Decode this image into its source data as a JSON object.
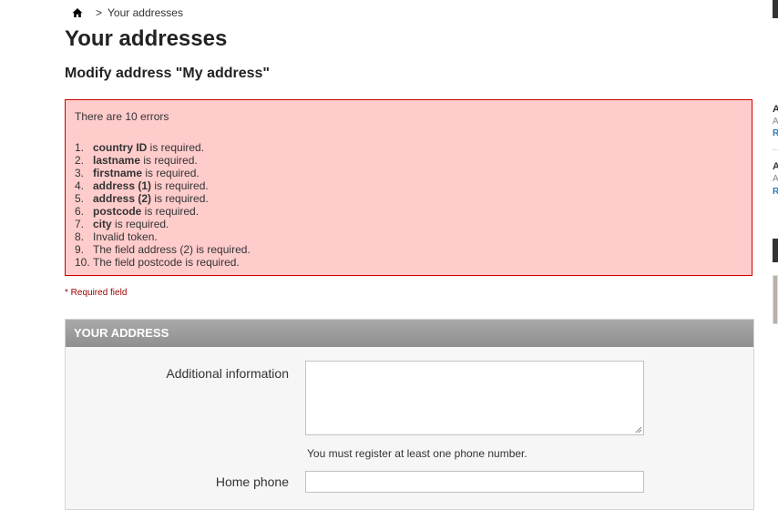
{
  "breadcrumb": {
    "home_icon": "home-icon",
    "separator": ">",
    "current": "Your addresses"
  },
  "page": {
    "title": "Your addresses",
    "subtitle": "Modify address \"My address\""
  },
  "errors": {
    "count_text": "There are 10 errors",
    "items": [
      {
        "num": "1.",
        "bold": "country ID",
        "rest": " is required."
      },
      {
        "num": "2.",
        "bold": "lastname",
        "rest": " is required."
      },
      {
        "num": "3.",
        "bold": "firstname",
        "rest": " is required."
      },
      {
        "num": "4.",
        "bold": "address (1)",
        "rest": " is required."
      },
      {
        "num": "5.",
        "bold": "address (2)",
        "rest": " is required."
      },
      {
        "num": "6.",
        "bold": "postcode",
        "rest": " is required."
      },
      {
        "num": "7.",
        "bold": "city",
        "rest": " is required."
      },
      {
        "num": "8.",
        "bold": "",
        "rest": "Invalid token."
      },
      {
        "num": "9.",
        "bold": "",
        "rest": "The field address (2) is required."
      },
      {
        "num": "10.",
        "bold": "",
        "rest": "The field postcode is required."
      }
    ]
  },
  "required_note": "* Required field",
  "form": {
    "header": "YOUR ADDRESS",
    "additional_info_label": "Additional information",
    "additional_info_value": "",
    "phone_note": "You must register at least one phone number.",
    "home_phone_label": "Home phone",
    "home_phone_value": ""
  },
  "edge": {
    "letter_a": "A",
    "letter_r": "R"
  },
  "colors": {
    "error_bg": "#ffcccc",
    "error_border": "#cc0000",
    "panel_header": "#999999",
    "link": "#2b7bc0"
  }
}
